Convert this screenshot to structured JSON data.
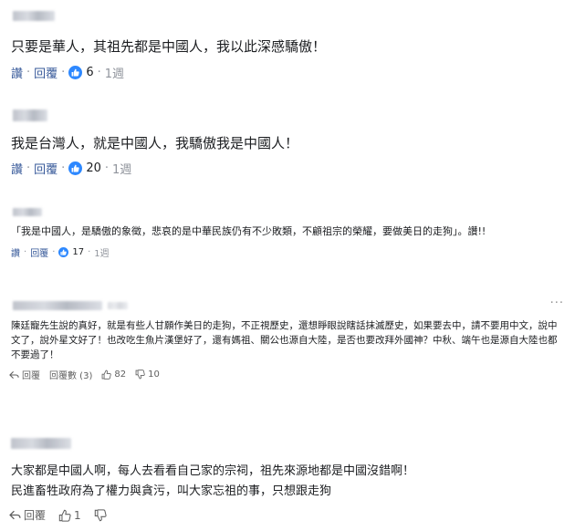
{
  "comments": [
    {
      "text": "只要是華人，其祖先都是中國人，我以此深感驕傲！",
      "actions": {
        "like": "讚",
        "reply": "回覆",
        "likes": "6",
        "time": "1週"
      }
    },
    {
      "text": "我是台灣人，就是中國人，我驕傲我是中國人！",
      "actions": {
        "like": "讚",
        "reply": "回覆",
        "likes": "20",
        "time": "1週"
      }
    },
    {
      "text": "「我是中國人，是驕傲的象徵，悲哀的是中華民族仍有不少敗類，不顧祖宗的榮耀，要做美日的走狗」。讚!!",
      "actions": {
        "like": "讚",
        "reply": "回覆",
        "likes": "17",
        "time": "1週"
      }
    },
    {
      "text": "陳廷寵先生說的真好，就是有些人甘願作美日的走狗，不正視歷史，還想睜眼說瞎話抹滅歷史，如果要去中，請不要用中文，說中文了，說外星文好了！也改吃生魚片漢堡好了，還有媽祖、關公也源自大陸，是否也要改拜外國神？中秋、端午也是源自大陸也都不要過了！",
      "more": "···",
      "actions": {
        "reply": "回覆",
        "view_replies": "回覆數 (3)",
        "likes": "82",
        "dislikes": "10"
      }
    },
    {
      "text_lines": [
        "大家都是中國人啊，每人去看看自己家的宗祠，祖先來源地都是中國沒錯啊！",
        "民進畜牲政府為了權力與貪污，叫大家忘祖的事，只想跟走狗"
      ],
      "actions": {
        "reply": "回覆",
        "likes": "1"
      }
    }
  ]
}
